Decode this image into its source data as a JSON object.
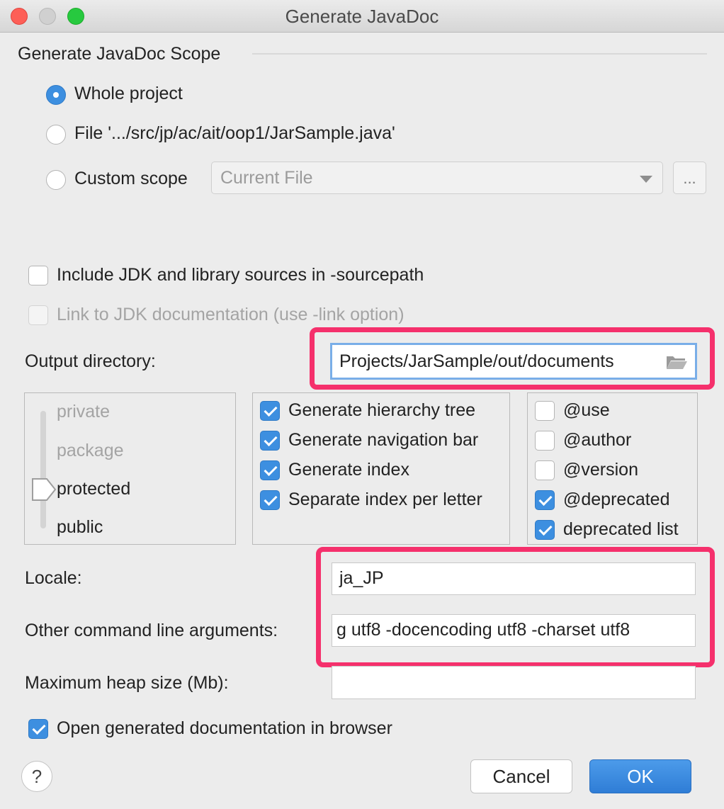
{
  "window": {
    "title": "Generate JavaDoc"
  },
  "scope": {
    "section_label": "Generate JavaDoc Scope",
    "options": [
      {
        "label": "Whole project",
        "selected": true
      },
      {
        "label": "File '.../src/jp/ac/ait/oop1/JarSample.java'",
        "selected": false
      },
      {
        "label": "Custom scope",
        "selected": false
      }
    ],
    "custom_scope_value": "Current File",
    "browse_label": "..."
  },
  "options": {
    "include_jdk_sources": {
      "label": "Include JDK and library sources in -sourcepath",
      "checked": false
    },
    "link_jdk_docs": {
      "label": "Link to JDK documentation (use -link option)",
      "checked": false,
      "disabled": true
    }
  },
  "output": {
    "label": "Output directory:",
    "value": "Projects/JarSample/out/documents"
  },
  "visibility": {
    "levels": [
      "private",
      "package",
      "protected",
      "public"
    ],
    "selected": "protected"
  },
  "generate": [
    {
      "label": "Generate hierarchy tree",
      "checked": true
    },
    {
      "label": "Generate navigation bar",
      "checked": true
    },
    {
      "label": "Generate index",
      "checked": true
    },
    {
      "label": "Separate index per letter",
      "checked": true
    }
  ],
  "tags": [
    {
      "label": "@use",
      "checked": false
    },
    {
      "label": "@author",
      "checked": false
    },
    {
      "label": "@version",
      "checked": false
    },
    {
      "label": "@deprecated",
      "checked": true
    },
    {
      "label": "deprecated list",
      "checked": true
    }
  ],
  "locale": {
    "label": "Locale:",
    "value": "ja_JP"
  },
  "other_args": {
    "label": "Other command line arguments:",
    "value": "g utf8 -docencoding utf8 -charset utf8"
  },
  "heap": {
    "label": "Maximum heap size (Mb):",
    "value": ""
  },
  "open_browser": {
    "label": "Open generated documentation in browser",
    "checked": true
  },
  "buttons": {
    "help": "?",
    "cancel": "Cancel",
    "ok": "OK"
  },
  "colors": {
    "accent": "#3d8fe0",
    "highlight": "#f5306c"
  }
}
